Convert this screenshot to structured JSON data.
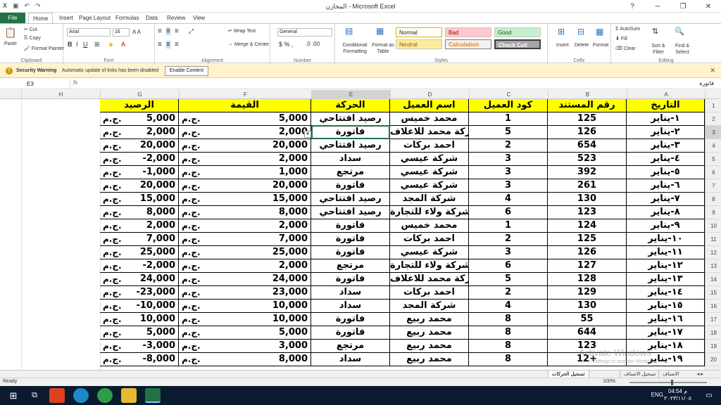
{
  "window": {
    "title": "المخازن - Microsoft Excel"
  },
  "ribbon_tabs": [
    "File",
    "Home",
    "Insert",
    "Page Layout",
    "Formulas",
    "Data",
    "Review",
    "View"
  ],
  "ribbon": {
    "clipboard": {
      "paste": "Paste",
      "cut": "Cut",
      "copy": "Copy",
      "format_painter": "Format Painter",
      "label": "Clipboard"
    },
    "font": {
      "name": "Arial",
      "size": "16",
      "label": "Font"
    },
    "alignment": {
      "wrap": "Wrap Text",
      "merge": "Merge & Center",
      "label": "Alignment"
    },
    "number": {
      "format": "General",
      "label": "Number"
    },
    "styles": {
      "conditional": "Conditional Formatting",
      "format_table": "Format as Table",
      "normal": "Normal",
      "bad": "Bad",
      "good": "Good",
      "neutral": "Neutral",
      "calculation": "Calculation",
      "check_cell": "Check Cell",
      "label": "Styles"
    },
    "cells": {
      "insert": "Insert",
      "delete": "Delete",
      "format": "Format",
      "label": "Cells"
    },
    "editing": {
      "autosum": "AutoSum",
      "fill": "Fill",
      "clear": "Clear",
      "sort": "Sort & Filter",
      "find": "Find & Select",
      "label": "Editing"
    }
  },
  "security": {
    "label": "Security Warning",
    "message": "Automatic update of links has been disabled",
    "button": "Enable Content"
  },
  "formula_bar": {
    "name_box": "E3",
    "fx": "fx",
    "value": "فاتورة"
  },
  "columns": [
    "H",
    "G",
    "F",
    "E",
    "D",
    "C",
    "B",
    "A"
  ],
  "headers": {
    "A": "التاريخ",
    "B": "رقم المستند",
    "C": "كود العميل",
    "D": "اسم العميل",
    "E": "الحركة",
    "F": "القيمة",
    "G": "الرصيد"
  },
  "currency": "ج.م.",
  "rows": [
    {
      "date": "١-يناير",
      "doc": "125",
      "code": "1",
      "name": "محمد خميس",
      "move": "رصيد افتتاحي",
      "value": "5,000",
      "balance": "5,000"
    },
    {
      "date": "٢-يناير",
      "doc": "126",
      "code": "5",
      "name": "شركة محمد للاعلاف",
      "move": "فاتورة",
      "value": "2,000",
      "balance": "2,000"
    },
    {
      "date": "٣-يناير",
      "doc": "654",
      "code": "2",
      "name": "احمد بركات",
      "move": "رصيد افتتاحي",
      "value": "20,000",
      "balance": "20,000"
    },
    {
      "date": "٤-يناير",
      "doc": "523",
      "code": "3",
      "name": "شركة عيسي",
      "move": "سداد",
      "value": "2,000",
      "balance": "-2,000"
    },
    {
      "date": "٥-يناير",
      "doc": "392",
      "code": "3",
      "name": "شركة عيسي",
      "move": "مرتجع",
      "value": "1,000",
      "balance": "-1,000"
    },
    {
      "date": "٦-يناير",
      "doc": "261",
      "code": "3",
      "name": "شركة عيسي",
      "move": "فاتورة",
      "value": "20,000",
      "balance": "20,000"
    },
    {
      "date": "٧-يناير",
      "doc": "130",
      "code": "4",
      "name": "شركة المجد",
      "move": "رصيد افتتاحي",
      "value": "15,000",
      "balance": "15,000"
    },
    {
      "date": "٨-يناير",
      "doc": "123",
      "code": "6",
      "name": "شركة ولاء للتجارة",
      "move": "رصيد افتتاحي",
      "value": "8,000",
      "balance": "8,000"
    },
    {
      "date": "٩-يناير",
      "doc": "124",
      "code": "1",
      "name": "محمد خميس",
      "move": "فاتورة",
      "value": "2,000",
      "balance": "2,000"
    },
    {
      "date": "١٠-يناير",
      "doc": "125",
      "code": "2",
      "name": "احمد بركات",
      "move": "فاتورة",
      "value": "7,000",
      "balance": "7,000"
    },
    {
      "date": "١١-يناير",
      "doc": "126",
      "code": "3",
      "name": "شركة عيسي",
      "move": "فاتورة",
      "value": "25,000",
      "balance": "25,000"
    },
    {
      "date": "١٢-يناير",
      "doc": "127",
      "code": "6",
      "name": "شركة ولاء للتجارة",
      "move": "مرتجع",
      "value": "2,000",
      "balance": "-2,000"
    },
    {
      "date": "١٣-يناير",
      "doc": "128",
      "code": "5",
      "name": "شركة محمد للاعلاف",
      "move": "فاتورة",
      "value": "24,000",
      "balance": "24,000"
    },
    {
      "date": "١٤-يناير",
      "doc": "129",
      "code": "2",
      "name": "احمد بركات",
      "move": "سداد",
      "value": "23,000",
      "balance": "-23,000"
    },
    {
      "date": "١٥-يناير",
      "doc": "130",
      "code": "4",
      "name": "شركة المجد",
      "move": "سداد",
      "value": "10,000",
      "balance": "-10,000"
    },
    {
      "date": "١٦-يناير",
      "doc": "55",
      "code": "8",
      "name": "محمد ربيع",
      "move": "فاتورة",
      "value": "10,000",
      "balance": "10,000"
    },
    {
      "date": "١٧-يناير",
      "doc": "644",
      "code": "8",
      "name": "محمد ربيع",
      "move": "فاتورة",
      "value": "5,000",
      "balance": "5,000"
    },
    {
      "date": "١٨-يناير",
      "doc": "123",
      "code": "8",
      "name": "محمد ربيع",
      "move": "مرتجع",
      "value": "3,000",
      "balance": "-3,000"
    },
    {
      "date": "١٩-يناير",
      "doc": "12+",
      "code": "8",
      "name": "محمد ربيع",
      "move": "سداد",
      "value": "8,000",
      "balance": "-8,000"
    }
  ],
  "row_numbers": [
    "1",
    "2",
    "3",
    "4",
    "5",
    "6",
    "7",
    "8",
    "9",
    "10",
    "11",
    "12",
    "13",
    "14",
    "15",
    "16",
    "17",
    "18",
    "19",
    "20"
  ],
  "sheet_tabs": [
    "الاصناف",
    "تسجيل الاصناف",
    "تسجيل الحركات"
  ],
  "status": {
    "ready": "Ready",
    "zoom": "100%"
  },
  "watermark": {
    "line1": "Activate Windows",
    "line2": "Go to Settings to activate Windows."
  },
  "taskbar": {
    "lang": "ENG",
    "time": "04:54 م",
    "date": "٢٠٢٣/١١/٠٥"
  }
}
